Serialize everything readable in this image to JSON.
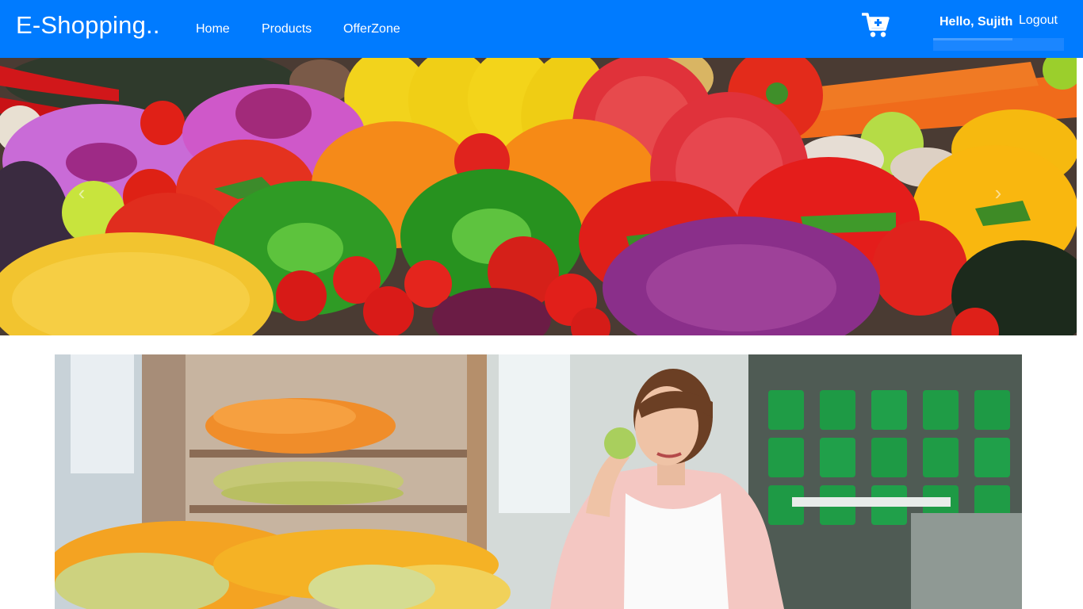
{
  "navbar": {
    "brand": "E-Shopping..",
    "links": [
      "Home",
      "Products",
      "OfferZone"
    ],
    "greeting": "Hello, Sujith",
    "logout": "Logout",
    "cart_icon": "cart-plus-icon",
    "color": "#007bff"
  },
  "carousel": {
    "image": "fresh vegetables and fruits",
    "prev_icon": "chevron-left-icon",
    "next_icon": "chevron-right-icon",
    "prev_glyph": "‹",
    "next_glyph": "›"
  },
  "promo": {
    "image": "woman eating apple in grocery store"
  }
}
